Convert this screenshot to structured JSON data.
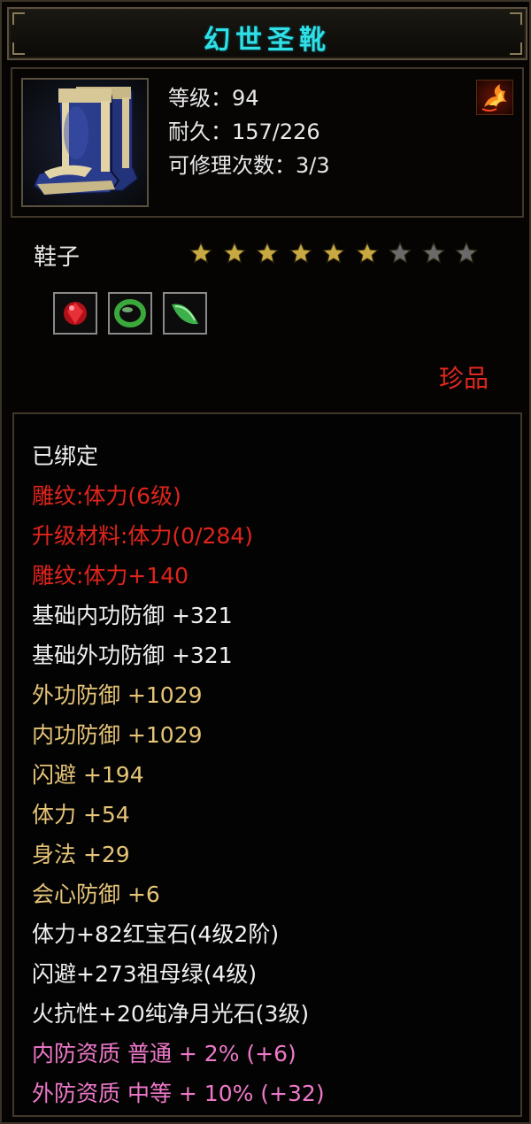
{
  "item": {
    "name": "幻世圣靴",
    "icon": "blue-boots-icon",
    "level_line": "等级：94",
    "durability_line": "耐久：157/226",
    "repair_line": "可修理次数：3/3",
    "element_icon": "fire-element-icon",
    "type": "鞋子",
    "stars": {
      "filled": 6,
      "total": 9
    },
    "gems": [
      "red-gem-icon",
      "green-ring-gem-icon",
      "green-leaf-gem-icon"
    ],
    "rarity": "珍品"
  },
  "attributes": [
    {
      "text": "已绑定",
      "color": "white"
    },
    {
      "text": "雕纹:体力(6级)",
      "color": "red"
    },
    {
      "text": "升级材料:体力(0/284)",
      "color": "red"
    },
    {
      "text": "雕纹:体力+140",
      "color": "red"
    },
    {
      "text": "基础内功防御 +321",
      "color": "white"
    },
    {
      "text": "基础外功防御 +321",
      "color": "white"
    },
    {
      "text": "外功防御 +1029",
      "color": "gold"
    },
    {
      "text": "内功防御 +1029",
      "color": "gold"
    },
    {
      "text": "闪避 +194",
      "color": "gold"
    },
    {
      "text": "体力 +54",
      "color": "gold"
    },
    {
      "text": "身法 +29",
      "color": "gold"
    },
    {
      "text": "会心防御 +6",
      "color": "gold"
    },
    {
      "text": "体力+82红宝石(4级2阶)",
      "color": "white"
    },
    {
      "text": "闪避+273祖母绿(4级)",
      "color": "white"
    },
    {
      "text": "火抗性+20纯净月光石(3级)",
      "color": "white"
    },
    {
      "text": "内防资质 普通 + 2% (+6)",
      "color": "pink"
    },
    {
      "text": "外防资质 中等 + 10% (+32)",
      "color": "pink"
    }
  ],
  "colors": {
    "title": "#2fe0e6",
    "red": "#e0241c",
    "gold": "#e6c478",
    "pink": "#ee78c8",
    "white": "#f0f0f0",
    "star_filled": "#c8a840",
    "star_empty": "#6a6a6a"
  }
}
